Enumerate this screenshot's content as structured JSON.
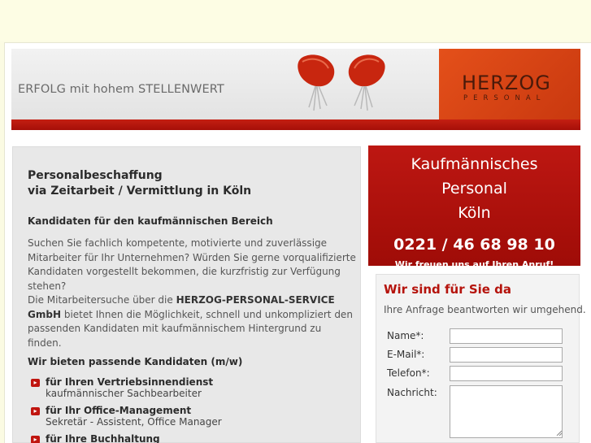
{
  "header": {
    "tagline": "ERFOLG mit hohem STELLENWERT",
    "logo_main": "HERZOG",
    "logo_sub": "PERSONAL"
  },
  "main": {
    "heading_line1": "Personalbeschaffung",
    "heading_line2": "via Zeitarbeit / Vermittlung in Köln",
    "subheading": "Kandidaten für den kaufmännischen Bereich",
    "para1": "Suchen Sie fachlich kompetente, motivierte und zuverlässige Mitarbeiter für Ihr Unternehmen? Würden Sie gerne vorqualifizierte Kandidaten vorgestellt bekommen, die kurzfristig zur Verfügung stehen?",
    "para2_prefix": "Die Mitarbeitersuche über die",
    "para2_company": "HERZOG-PERSONAL-SERVICE GmbH",
    "para2_suffix": "bietet Ihnen die Möglichkeit, schnell und unkompliziert den passenden Kandidaten mit kaufmännischem Hintergrund zu finden.",
    "offer_heading": "Wir bieten passende Kandidaten (m/w)",
    "bullets": [
      {
        "title": "für Ihren Vertriebsinnendienst",
        "sub": "kaufmännischer Sachbearbeiter"
      },
      {
        "title": "für Ihr Office-Management",
        "sub": "Sekretär - Assistent, Office Manager"
      },
      {
        "title": "für Ihre Buchhaltung",
        "sub": ""
      }
    ]
  },
  "promo": {
    "line1": "Kaufmännisches",
    "line2": "Personal",
    "line3": "Köln",
    "phone": "0221 / 46 68 98 10",
    "cut_text": "Wir freuen uns auf Ihren Anruf!"
  },
  "form": {
    "title": "Wir sind für Sie da",
    "intro": "Ihre Anfrage beantworten wir umgehend.",
    "name_label": "Name*:",
    "email_label": "E-Mail*:",
    "phone_label": "Telefon*:",
    "message_label": "Nachricht:",
    "name_value": "",
    "email_value": "",
    "phone_value": "",
    "message_value": ""
  },
  "colors": {
    "accent_red": "#b5130c",
    "logo_orange": "#e4501a",
    "background": "#fbfbe3"
  }
}
